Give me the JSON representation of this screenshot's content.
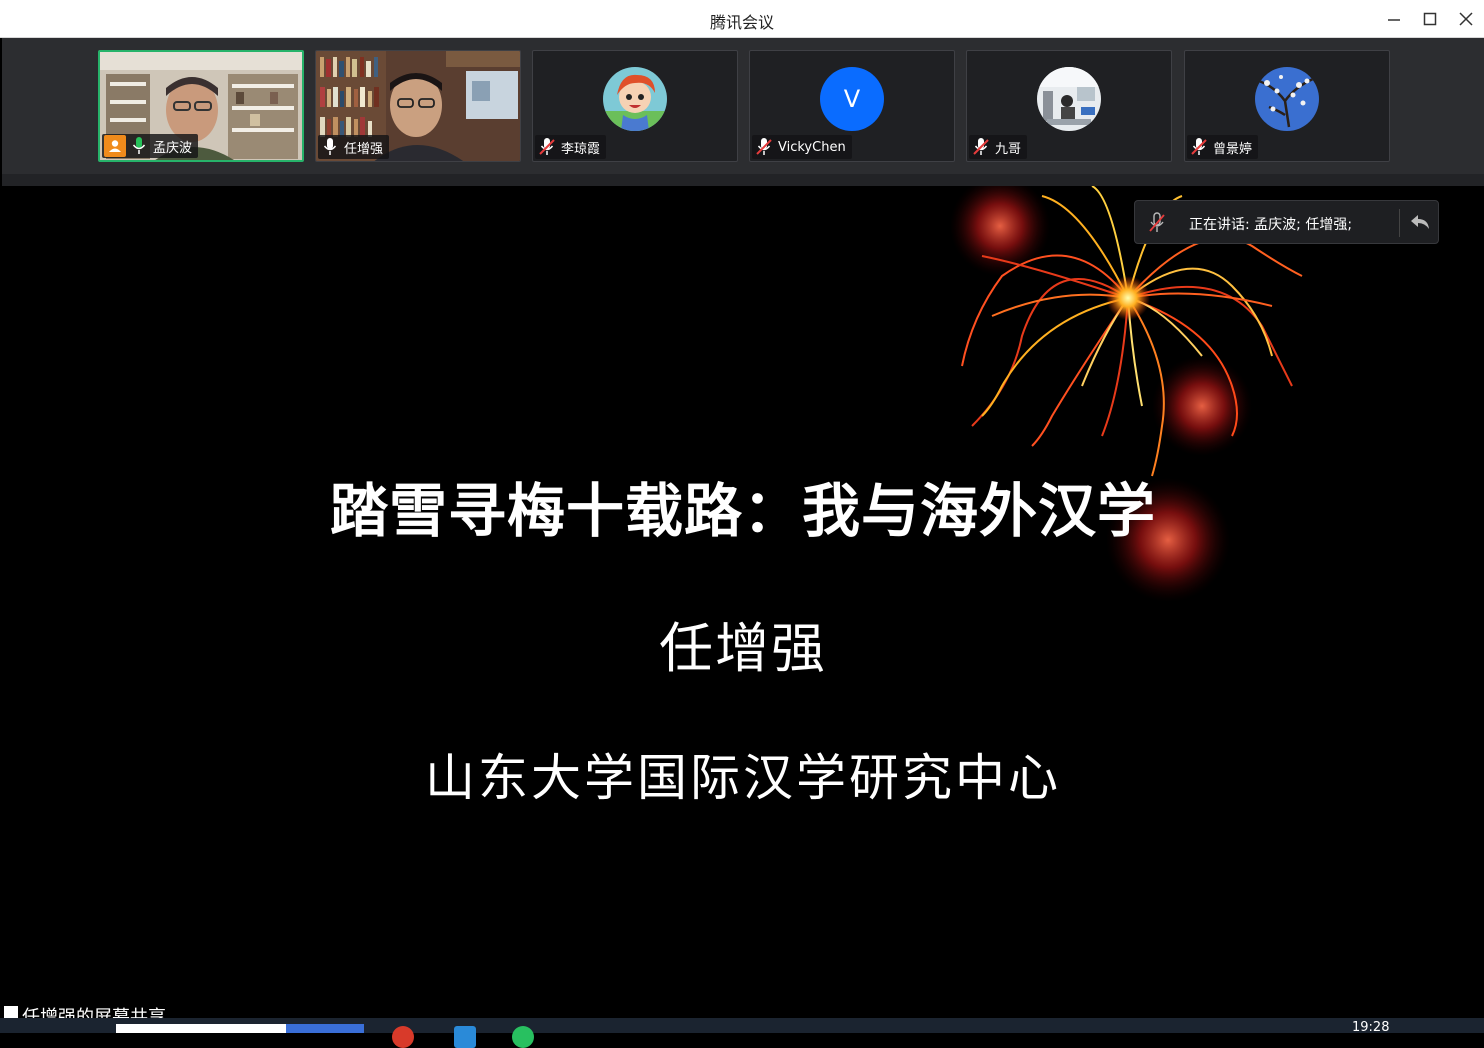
{
  "window": {
    "title": "腾讯会议"
  },
  "participants": [
    {
      "name": "孟庆波",
      "mic": "on",
      "host": true,
      "active": true,
      "kind": "video"
    },
    {
      "name": "任增强",
      "mic": "on",
      "host": false,
      "active": false,
      "kind": "video"
    },
    {
      "name": "李琼霞",
      "mic": "muted",
      "host": false,
      "active": false,
      "kind": "avatar"
    },
    {
      "name": "VickyChen",
      "mic": "muted",
      "host": false,
      "active": false,
      "kind": "letter",
      "letter": "V"
    },
    {
      "name": "九哥",
      "mic": "muted",
      "host": false,
      "active": false,
      "kind": "avatar"
    },
    {
      "name": "曾景婷",
      "mic": "muted",
      "host": false,
      "active": false,
      "kind": "avatar"
    }
  ],
  "speaking": {
    "text": "正在讲话: 孟庆波; 任增强;"
  },
  "slide": {
    "title": "踏雪寻梅十载路：我与海外汉学",
    "author": "任增强",
    "organization": "山东大学国际汉学研究中心"
  },
  "share_banner": {
    "text": "任增强的屏幕共享"
  },
  "taskbar": {
    "time": "19:28"
  },
  "colors": {
    "active_border": "#27b36a",
    "host_badge": "#f08b1c",
    "letter_avatar": "#0a6cff",
    "stage": "#000000"
  }
}
